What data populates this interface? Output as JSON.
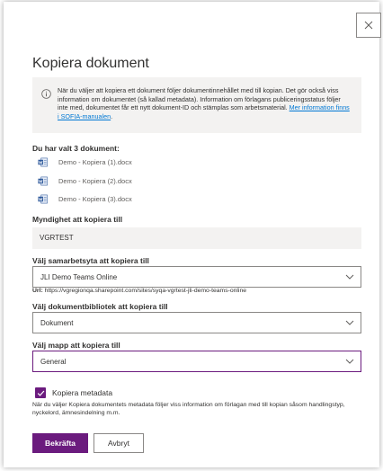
{
  "dialog": {
    "title": "Kopiera dokument",
    "close_icon": "close-icon",
    "info": {
      "icon": "info-icon",
      "text": "När du väljer att kopiera ett dokument följer dokumentinnehållet med till kopian. Det gör också viss information om dokumentet (så kallad metadata). Information om förlagans publiceringsstatus följer inte med, dokumentet får ett nytt dokument-ID och stämplas som arbetsmaterial.",
      "link": "Mer information finns i SOFIA-manualen"
    },
    "selected_label": "Du har valt 3 dokument:",
    "documents": [
      {
        "name": "Demo - Kopiera (1).docx",
        "icon": "word-doc-icon"
      },
      {
        "name": "Demo - Kopiera (2).docx",
        "icon": "word-doc-icon"
      },
      {
        "name": "Demo - Kopiera (3).docx",
        "icon": "word-doc-icon"
      }
    ],
    "authority": {
      "label": "Myndighet att kopiera till",
      "value": "VGRTEST"
    },
    "site": {
      "label": "Välj samarbetsyta att kopiera till",
      "value": "JLI Demo Teams Online",
      "url_label": "Url:",
      "url": "https://vgregionqa.sharepoint.com/sites/syqa-vgrtest-jli-demo-teams-online"
    },
    "library": {
      "label": "Välj dokumentbibliotek att kopiera till",
      "value": "Dokument"
    },
    "folder": {
      "label": "Välj mapp att kopiera till",
      "value": "General"
    },
    "metadata": {
      "label": "Kopiera metadata",
      "checked": true,
      "description": "När du väljer Kopiera dokumentets metadata följer viss information om förlagan med till kopian såsom handlingstyp, nyckelord, ämnesindelning m.m."
    },
    "buttons": {
      "confirm": "Bekräfta",
      "cancel": "Avbryt"
    },
    "colors": {
      "accent": "#6b1b7e",
      "link": "#0078d4",
      "word_blue": "#2b579a"
    }
  }
}
